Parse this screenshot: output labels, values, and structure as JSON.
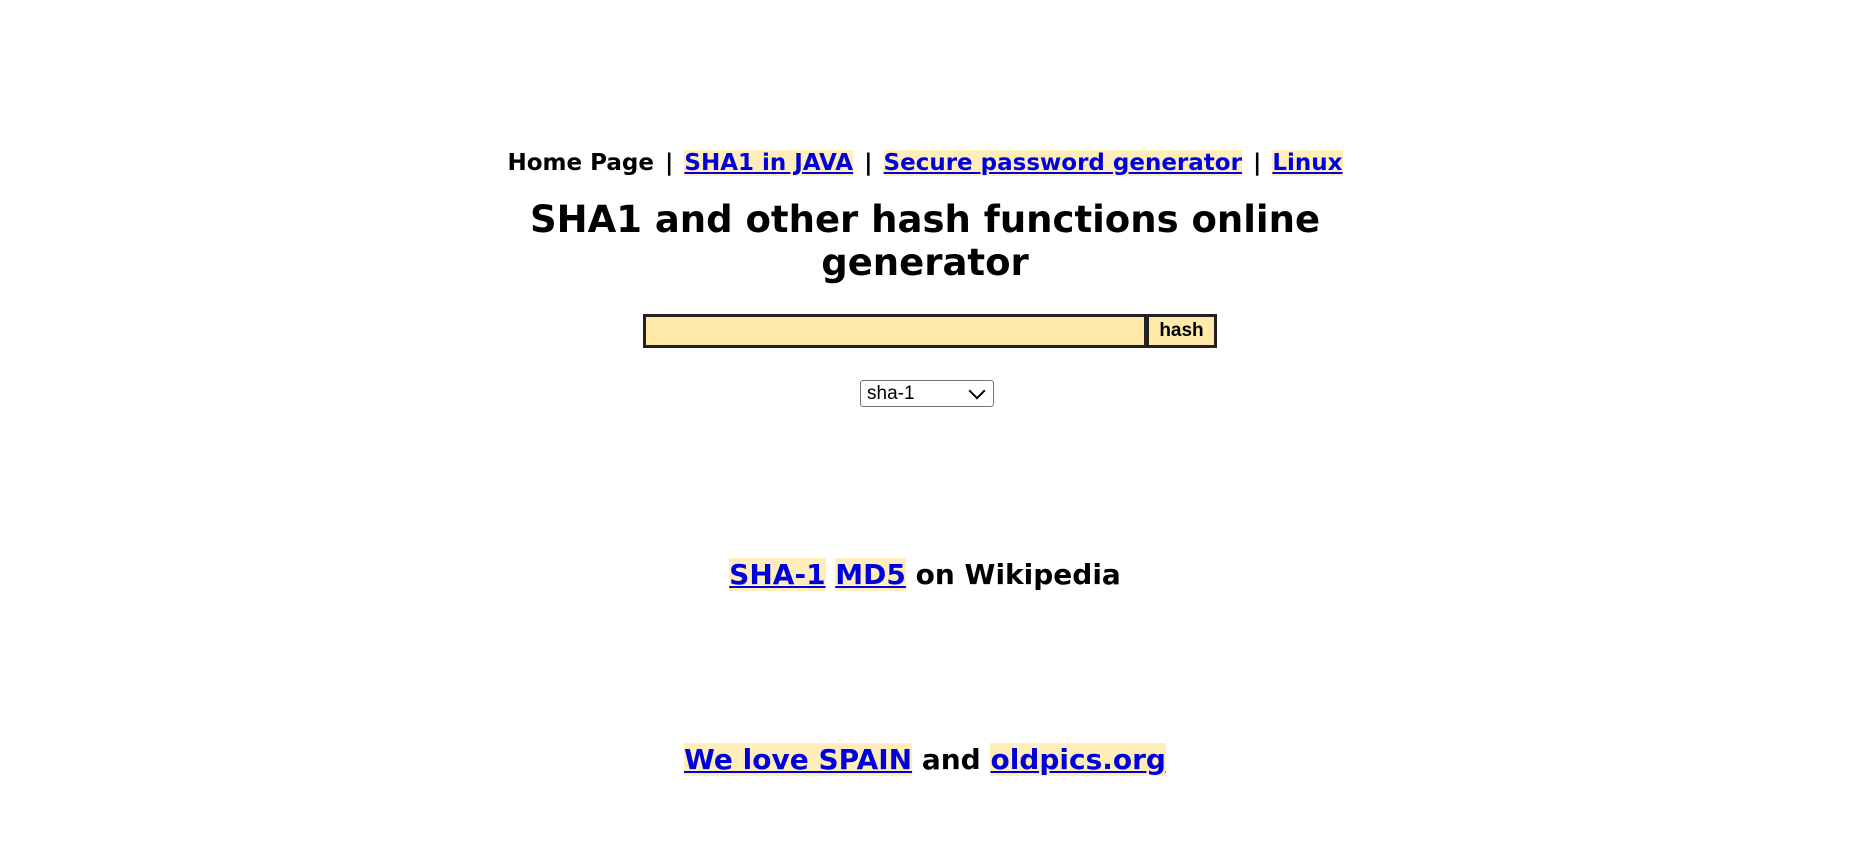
{
  "nav": {
    "home": "Home Page",
    "separator": "|",
    "links": [
      "SHA1 in JAVA",
      "Secure password generator",
      "Linux"
    ]
  },
  "title": {
    "line1": "SHA1 and other hash functions online",
    "line2": "generator"
  },
  "form": {
    "input_value": "",
    "button_label": "hash",
    "algorithm_selected": "sha-1"
  },
  "wiki": {
    "links": [
      "SHA-1",
      "MD5"
    ],
    "suffix": "on Wikipedia"
  },
  "footer": {
    "link1": "We love SPAIN",
    "conjunction": "and",
    "link2": "oldpics.org"
  },
  "colors": {
    "link": "#0000dd",
    "highlight": "#ffeebb",
    "field_background": "#ffeaa9"
  }
}
